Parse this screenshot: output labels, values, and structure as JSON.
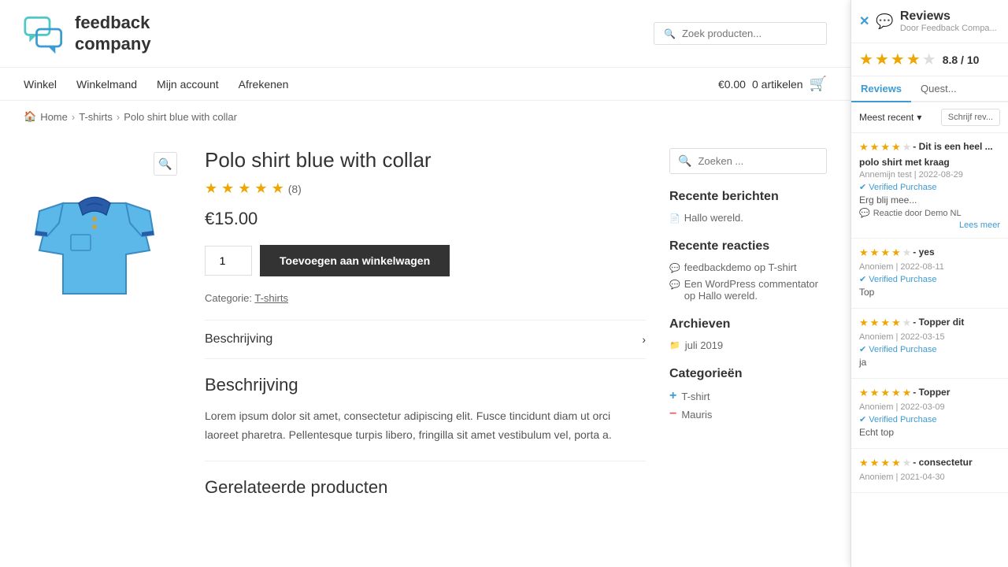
{
  "header": {
    "logo_text_line1": "feedback",
    "logo_text_line2": "company",
    "search_placeholder": "Zoek producten..."
  },
  "nav": {
    "links": [
      {
        "label": "Winkel",
        "href": "#"
      },
      {
        "label": "Winkelmand",
        "href": "#"
      },
      {
        "label": "Mijn account",
        "href": "#"
      },
      {
        "label": "Afrekenen",
        "href": "#"
      }
    ],
    "cart_price": "€0.00",
    "cart_items": "0 artikelen"
  },
  "breadcrumb": {
    "home": "Home",
    "tshirts": "T-shirts",
    "current": "Polo shirt blue with collar"
  },
  "product": {
    "title": "Polo shirt blue with collar",
    "rating": "4.5",
    "review_count": "(8)",
    "price": "€15.00",
    "qty_value": "1",
    "add_button": "Toevoegen aan winkelwagen",
    "category_label": "Categorie:",
    "category": "T-shirts"
  },
  "tabs": [
    {
      "label": "Beschrijving"
    }
  ],
  "description": {
    "title": "Beschrijving",
    "text": "Lorem ipsum dolor sit amet, consectetur adipiscing elit. Fusce tincidunt diam ut orci laoreet pharetra. Pellentesque turpis libero, fringilla sit amet vestibulum vel, porta a."
  },
  "sidebar": {
    "search_placeholder": "Zoeken ...",
    "recent_posts_title": "Recente berichten",
    "recent_posts": [
      {
        "label": "Hallo wereld.",
        "href": "#"
      }
    ],
    "recent_comments_title": "Recente reacties",
    "comments": [
      {
        "author": "feedbackdemo",
        "text": "op",
        "link": "T-shirt",
        "href": "#"
      },
      {
        "author": "Een WordPress commentator",
        "text": "op",
        "link": "Hallo wereld.",
        "href": "#"
      }
    ],
    "archives_title": "Archieven",
    "archives": [
      {
        "label": "juli 2019",
        "href": "#"
      }
    ],
    "categories_title": "Categorieën",
    "categories": [
      {
        "label": "T-shirt",
        "href": "#",
        "type": "plus"
      },
      {
        "label": "Mauris",
        "href": "#",
        "type": "minus"
      }
    ]
  },
  "related_title": "Gerelateerde producten",
  "reviews_panel": {
    "title": "Reviews",
    "subtitle": "Door Feedback Compa...",
    "rating_score": "8.8 / 10",
    "tabs": [
      "Reviews",
      "Quest..."
    ],
    "sort_label": "Meest recent",
    "write_label": "Schrijf rev...",
    "reviews": [
      {
        "stars": 4,
        "title": "- Dit is een heel ...",
        "subtitle": "polo shirt met kraag",
        "meta": "Annemijn test | 2022-08-29",
        "verified": "Verified Purchase",
        "text": "Erg blij mee...",
        "response": "Reactie door Demo NL",
        "lees_meer": "Lees meer"
      },
      {
        "stars": 4,
        "title": "- yes",
        "subtitle": "",
        "meta": "Anoniem | 2022-08-11",
        "verified": "Verified Purchase",
        "text": "Top",
        "response": "",
        "lees_meer": ""
      },
      {
        "stars": 4,
        "title": "- Topper dit",
        "subtitle": "",
        "meta": "Anoniem | 2022-03-15",
        "verified": "Verified Purchase",
        "text": "ja",
        "response": "",
        "lees_meer": ""
      },
      {
        "stars": 5,
        "title": "- Topper",
        "subtitle": "",
        "meta": "Anoniem | 2022-03-09",
        "verified": "Verified Purchase",
        "text": "Echt top",
        "response": "",
        "lees_meer": ""
      },
      {
        "stars": 4,
        "title": "- consectetur",
        "subtitle": "",
        "meta": "Anoniem | 2021-04-30",
        "verified": "",
        "text": "",
        "response": "",
        "lees_meer": ""
      }
    ]
  }
}
